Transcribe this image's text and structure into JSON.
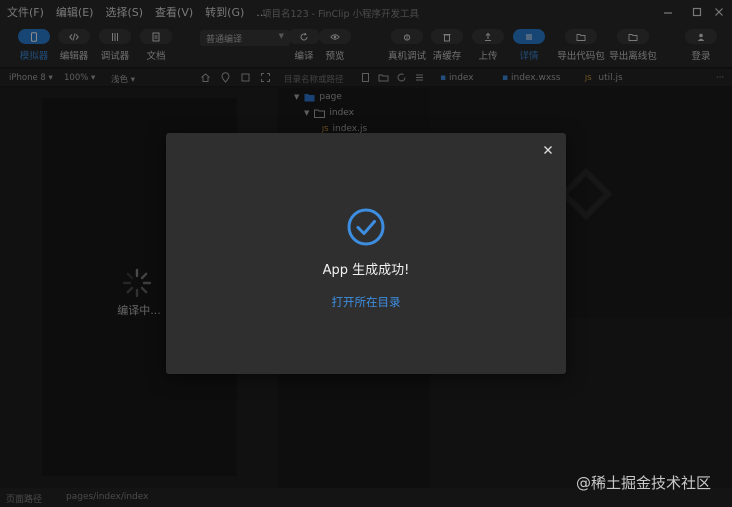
{
  "menu": {
    "items": [
      "文件(F)",
      "编辑(E)",
      "选择(S)",
      "查看(V)",
      "转到(G)",
      "..."
    ],
    "title": "项目名123 - FinClip 小程序开发工具"
  },
  "toolbar": {
    "simulator": "模拟器",
    "editor": "编辑器",
    "debugger": "调试器",
    "docs": "文档",
    "compile_mode": "普通编译",
    "compile": "编译",
    "preview": "预览",
    "real_debug": "真机调试",
    "clear_cache": "清缓存",
    "upload": "上传",
    "details": "详情",
    "export_code": "导出代码包",
    "export_offline": "导出离线包",
    "login": "登录"
  },
  "subbar": {
    "device": "iPhone 8",
    "zoom": "100%",
    "theme": "浅色",
    "file_search_placeholder": "目录名称或路径"
  },
  "tabs": [
    {
      "label": "index",
      "tag": ""
    },
    {
      "label": "index.wxss",
      "tag": ""
    },
    {
      "label": "util.js",
      "tag": "JS"
    }
  ],
  "tree": {
    "page": "page",
    "index": "index",
    "index_js": "index.js",
    "js_tag": "JS"
  },
  "simulator": {
    "status": "编译中..."
  },
  "dialog": {
    "message": "App 生成成功!",
    "open_dir": "打开所在目录"
  },
  "statusbar": {
    "path_label": "页面路径",
    "path_value": "pages/index/index"
  },
  "watermark": "@稀土掘金技术社区",
  "colors": {
    "accent": "#2a7fd4",
    "link": "#3d8ee0",
    "dialog_bg": "#2f2f2f"
  }
}
